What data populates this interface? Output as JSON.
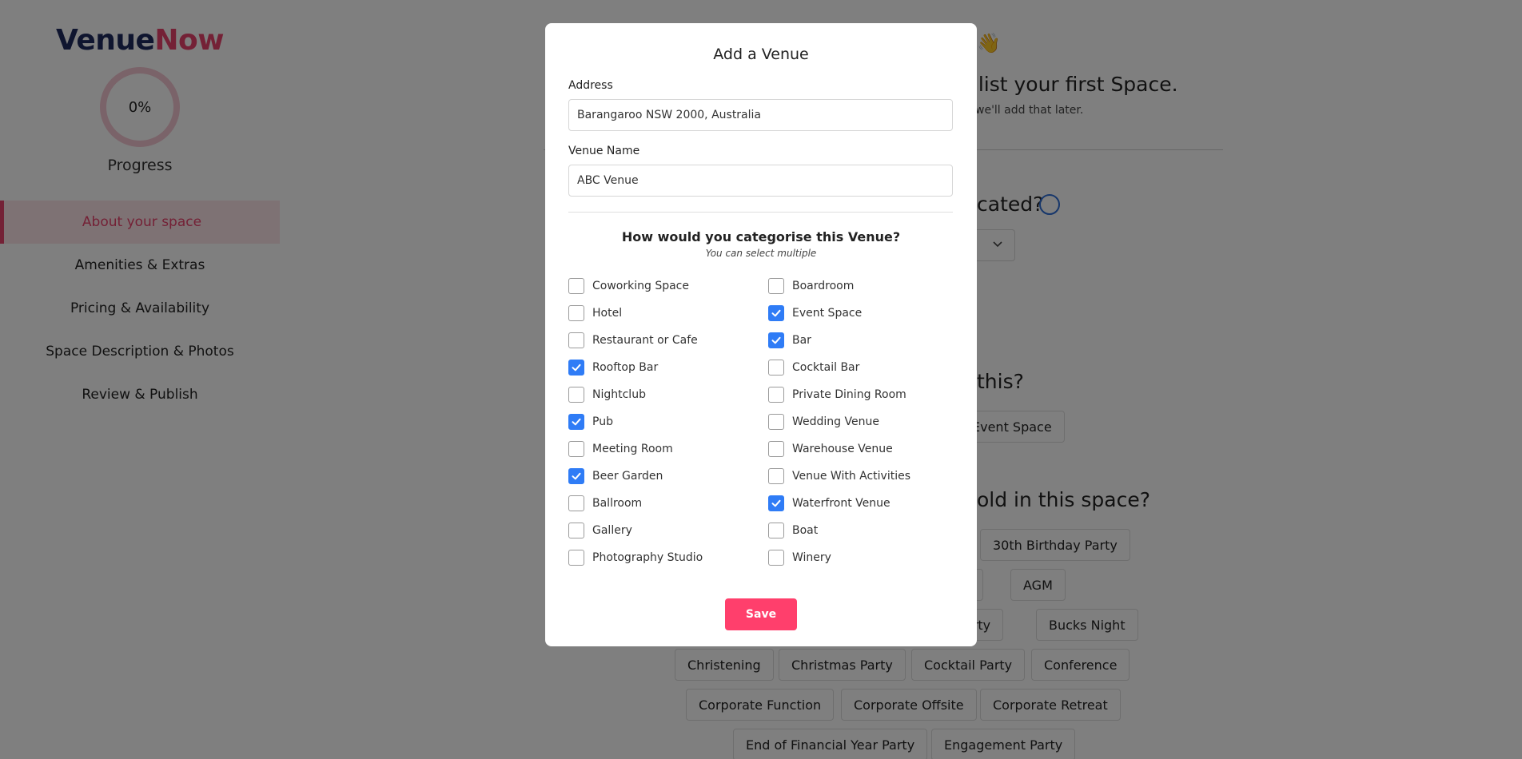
{
  "brand": {
    "part1": "Venue",
    "part2": "Now"
  },
  "progress": {
    "value": "0%",
    "label": "Progress"
  },
  "sidebar": {
    "items": [
      {
        "label": "About your space",
        "active": true
      },
      {
        "label": "Amenities & Extras"
      },
      {
        "label": "Pricing & Availability"
      },
      {
        "label": "Space Description & Photos"
      },
      {
        "label": "Review & Publish"
      }
    ]
  },
  "background": {
    "headline_fragment": "d list your first Space.",
    "sub_fragment": "we'll add that later.",
    "q1_fragment": "cated?",
    "q2_fragment": "this?",
    "q3_fragment": "old in this space?",
    "chips": [
      "Event Space",
      "30th Birthday Party",
      "ty",
      "AGM",
      "Party",
      "Bucks Night",
      "Christening",
      "Christmas Party",
      "Cocktail Party",
      "Conference",
      "Corporate Function",
      "Corporate Offsite",
      "Corporate Retreat",
      "End of Financial Year Party",
      "Engagement Party"
    ]
  },
  "modal": {
    "title": "Add a Venue",
    "address_label": "Address",
    "address_value": "Barangaroo NSW 2000, Australia",
    "venue_name_label": "Venue Name",
    "venue_name_value": "ABC Venue",
    "category_title": "How would you categorise this Venue?",
    "category_subtitle": "You can select multiple",
    "categories_left": [
      {
        "label": "Coworking Space",
        "checked": false
      },
      {
        "label": "Hotel",
        "checked": false
      },
      {
        "label": "Restaurant or Cafe",
        "checked": false
      },
      {
        "label": "Rooftop Bar",
        "checked": true
      },
      {
        "label": "Nightclub",
        "checked": false
      },
      {
        "label": "Pub",
        "checked": true
      },
      {
        "label": "Meeting Room",
        "checked": false
      },
      {
        "label": "Beer Garden",
        "checked": true
      },
      {
        "label": "Ballroom",
        "checked": false
      },
      {
        "label": "Gallery",
        "checked": false
      },
      {
        "label": "Photography Studio",
        "checked": false
      }
    ],
    "categories_right": [
      {
        "label": "Boardroom",
        "checked": false
      },
      {
        "label": "Event Space",
        "checked": true
      },
      {
        "label": "Bar",
        "checked": true
      },
      {
        "label": "Cocktail Bar",
        "checked": false
      },
      {
        "label": "Private Dining Room",
        "checked": false
      },
      {
        "label": "Wedding Venue",
        "checked": false
      },
      {
        "label": "Warehouse Venue",
        "checked": false
      },
      {
        "label": "Venue With Activities",
        "checked": false
      },
      {
        "label": "Waterfront Venue",
        "checked": true
      },
      {
        "label": "Boat",
        "checked": false
      },
      {
        "label": "Winery",
        "checked": false
      }
    ],
    "save_label": "Save"
  },
  "colors": {
    "brand_navy": "#1e2a5e",
    "brand_pink": "#e8426c",
    "checkbox_blue": "#2f7cf6",
    "save_button": "#ff3f6c"
  }
}
